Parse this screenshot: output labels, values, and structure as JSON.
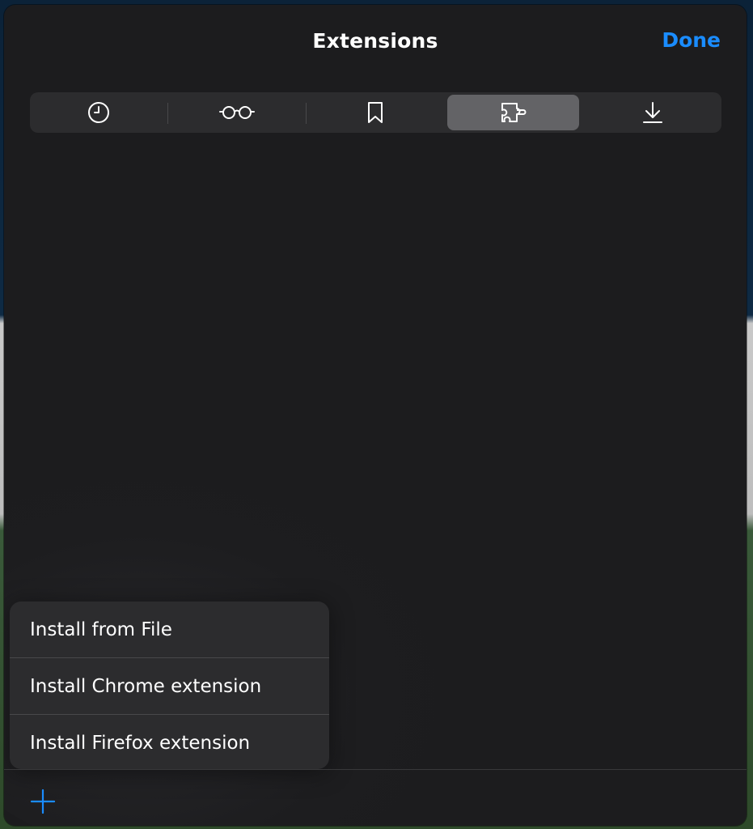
{
  "header": {
    "title": "Extensions",
    "done_label": "Done"
  },
  "tabs": [
    {
      "icon": "clock-icon",
      "name": "history",
      "selected": false
    },
    {
      "icon": "glasses-icon",
      "name": "reading-list",
      "selected": false
    },
    {
      "icon": "bookmark-icon",
      "name": "bookmarks",
      "selected": false
    },
    {
      "icon": "puzzle-piece-icon",
      "name": "extensions",
      "selected": true
    },
    {
      "icon": "download-icon",
      "name": "downloads",
      "selected": false
    }
  ],
  "menu": {
    "items": [
      {
        "label": "Install from File"
      },
      {
        "label": "Install Chrome extension"
      },
      {
        "label": "Install Firefox extension"
      }
    ]
  },
  "toolbar": {
    "add_icon": "plus-icon"
  },
  "colors": {
    "accent": "#1a8cff",
    "sheet_background": "#1c1c1e",
    "selected_segment": "#636366"
  }
}
